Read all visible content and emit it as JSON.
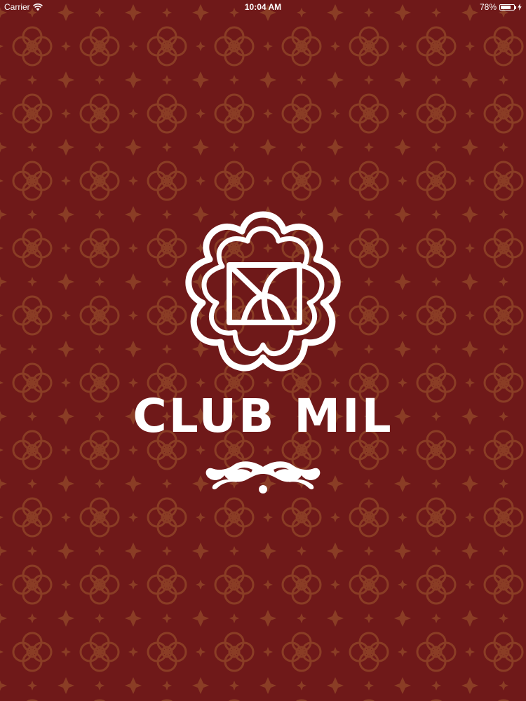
{
  "status_bar": {
    "carrier": "Carrier",
    "time": "10:04 AM",
    "battery_percent_text": "78%",
    "battery_level": 0.78,
    "icons": [
      "wifi-icon",
      "battery-icon",
      "charging-icon"
    ]
  },
  "splash": {
    "brand_name": "CLUB MIL",
    "logo_icon": "club-mil-flower-emblem",
    "ornament_icon": "flourish-ornament"
  },
  "colors": {
    "background": "#6f1919",
    "pattern": "#8e4326",
    "foreground": "#ffffff"
  }
}
